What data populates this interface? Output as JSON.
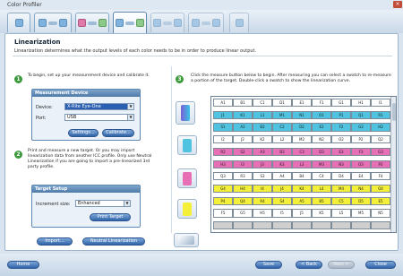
{
  "window": {
    "title": "Color Profiler",
    "close_glyph": "×"
  },
  "panel": {
    "title": "Linearization",
    "subtitle": "Linearization determines what the output levels of each color needs to be in order to produce linear output."
  },
  "step1": {
    "badge": "1",
    "text": "To begin, set up your measurement device and calibrate it.",
    "group_title": "Measurement Device",
    "device_label": "Device:",
    "device_value": "X-Rite Eye-One",
    "port_label": "Port:",
    "port_value": "USB",
    "settings_label": "Settings...",
    "calibrate_label": "Calibrate..."
  },
  "step2": {
    "badge": "2",
    "text": "Print and measure a new target. Or you may import linearization data from another ICC profile. Only use Neutral Linearization if you are going to import a pre-linearized 3rd party profile.",
    "group_title": "Target Setup",
    "increment_label": "Increment size:",
    "increment_value": "Enhanced",
    "print_target_label": "Print Target",
    "import_label": "Import...",
    "neutral_label": "Neutral Linearization"
  },
  "step3": {
    "badge": "3",
    "text": "Click the measure button below to begin. After measuring you can select a swatch to re-measure a portion of the target. Double-click a swatch to show the linearization curve."
  },
  "grid": {
    "rows": [
      {
        "color": "#ffffff",
        "cells": [
          "A1",
          "B1",
          "C1",
          "D1",
          "E1",
          "F1",
          "G1",
          "H1",
          "I1"
        ]
      },
      {
        "color": "#4fc3df",
        "cells": [
          "J1",
          "K1",
          "L1",
          "M1",
          "N1",
          "O1",
          "P1",
          "Q1",
          "R1"
        ]
      },
      {
        "color": "#4fc3df",
        "cells": [
          "S1",
          "A2",
          "B2",
          "C2",
          "D2",
          "E2",
          "F2",
          "G2",
          "H2"
        ]
      },
      {
        "color": "#ffffff",
        "cells": [
          "I2",
          "J2",
          "K2",
          "L2",
          "M2",
          "N2",
          "O2",
          "P2",
          "Q2"
        ]
      },
      {
        "color": "#e66fb6",
        "cells": [
          "R2",
          "S2",
          "A3",
          "B3",
          "C3",
          "D3",
          "E3",
          "F3",
          "G3"
        ]
      },
      {
        "color": "#e66fb6",
        "cells": [
          "H3",
          "I3",
          "J3",
          "K3",
          "L3",
          "M3",
          "N3",
          "O3",
          "P3"
        ]
      },
      {
        "color": "#ffffff",
        "cells": [
          "Q3",
          "R3",
          "S3",
          "A4",
          "B4",
          "C4",
          "D4",
          "E4",
          "F4"
        ]
      },
      {
        "color": "#f4f03a",
        "cells": [
          "G4",
          "H4",
          "I4",
          "J4",
          "K4",
          "L4",
          "M4",
          "N4",
          "O4"
        ]
      },
      {
        "color": "#f4f03a",
        "cells": [
          "P4",
          "Q4",
          "R4",
          "S4",
          "A5",
          "B5",
          "C5",
          "D5",
          "E5"
        ]
      },
      {
        "color": "#ffffff",
        "cells": [
          "F5",
          "G5",
          "H5",
          "I5",
          "J5",
          "K5",
          "L5",
          "M5",
          "N5"
        ]
      },
      {
        "color": "#cfcfcf",
        "cells": [
          "",
          "",
          "",
          "",
          "",
          "",
          "",
          "",
          ""
        ]
      }
    ]
  },
  "bottom": {
    "home": "Home",
    "save": "Save",
    "back": "< Back",
    "next": "Next >",
    "close": "Close"
  }
}
